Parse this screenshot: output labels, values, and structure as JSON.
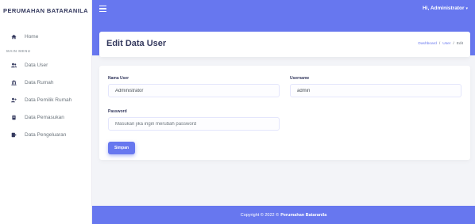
{
  "sidebar": {
    "brand": "PERUMAHAN BATARANILA",
    "home": "Home",
    "menu_header": "MAIN MENU",
    "items": [
      {
        "label": "Data User",
        "icon": "users-icon"
      },
      {
        "label": "Data Rumah",
        "icon": "building-icon"
      },
      {
        "label": "Data Pemilik Rumah",
        "icon": "user-plus-icon"
      },
      {
        "label": "Data Pemasukan",
        "icon": "income-icon"
      },
      {
        "label": "Data Pengeluaran",
        "icon": "expense-icon"
      }
    ]
  },
  "topbar": {
    "user_greeting": "Hi, Administrator",
    "caret": "▾"
  },
  "header": {
    "title": "Edit Data User",
    "breadcrumb": [
      "Dashboard",
      "User",
      "Edit"
    ],
    "breadcrumb_sep": "/"
  },
  "form": {
    "nama_label": "Nama User",
    "nama_value": "Administrator",
    "username_label": "Username",
    "username_value": "admin",
    "password_label": "Password",
    "password_placeholder": "Masukan jika ingin merubah password",
    "submit_label": "Simpan"
  },
  "footer": {
    "text": "Copyright © 2022 ©",
    "brand": "Perumahan Bataranila"
  },
  "colors": {
    "primary": "#6777ef",
    "background": "#f3f4f8",
    "text_dark": "#34395e"
  }
}
